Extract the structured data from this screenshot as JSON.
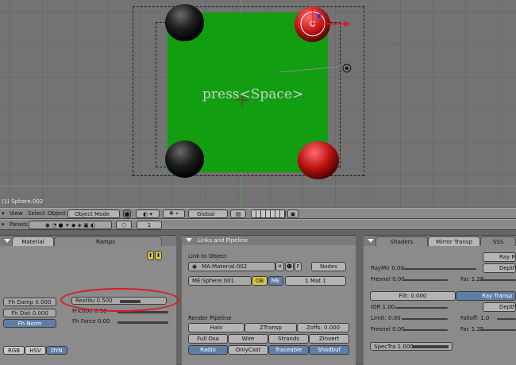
{
  "viewport": {
    "overlay_text": "press<Space>",
    "object_label": "(1) Sphere.002"
  },
  "header": {
    "menus": [
      "View",
      "Select",
      "Object"
    ],
    "mode": "Object Mode",
    "pivot": "Global"
  },
  "buttons_header": {
    "panels_label": "Panels",
    "frame_value": "1"
  },
  "material_panel": {
    "tabs": [
      "Material",
      "Ramps"
    ],
    "fields": {
      "fh_damp": "Fh Damp 0.000",
      "fh_dist": "Fh Dist 0.000",
      "fh_norm": "Fh Norm",
      "restitution": "Restitu 0.500",
      "friction": "Friction 0.50",
      "fh_force": "Fh Force 0.00"
    },
    "color_modes": [
      "RGB",
      "HSV",
      "DYN"
    ],
    "active_color_mode": "DYN"
  },
  "links_panel": {
    "title": "Links and Pipeline",
    "link_to_object": "Link to Object",
    "material_name": "MA:Material.002",
    "f_label": "F",
    "nodes_label": "Nodes",
    "me_name": "ME:Sphere.001",
    "ob_label": "OB",
    "me_label": "ME",
    "mat_count": "1 Mat 1",
    "render_pipeline": "Render Pipeline",
    "pipeline_buttons": [
      "Halo",
      "ZTransp",
      "Zoffs: 0.000",
      "Full Osa",
      "Wire",
      "Strands",
      "ZInvert",
      "Radio",
      "OnlyCast",
      "Traceable",
      "Shadbuf"
    ]
  },
  "mirror_panel": {
    "tabs": [
      "Shaders",
      "Mirror Transp",
      "SSS"
    ],
    "ray_mir_btn": "Ray Mir",
    "ray_mir": "RayMir 0.00",
    "depth_1": "Depth",
    "fresnel_1": "Fresnel 0.00",
    "fac_1": "Fac 1.25",
    "filt": "Filt: 0.000",
    "ray_transp_btn": "Ray Transp",
    "ior": "IOR 1.00",
    "depth_2": "Depth",
    "limit": "Limit: 0.00",
    "falloff": "Falloff: 1.0",
    "fresnel_2": "Fresnel 0.00",
    "fac_2": "Fac 1.25",
    "spec_tra": "SpecTra 1.000"
  },
  "colors": {
    "plane_green": "#119f11",
    "highlight_red": "#e0171f",
    "active_blue": "#5f7ea6"
  }
}
